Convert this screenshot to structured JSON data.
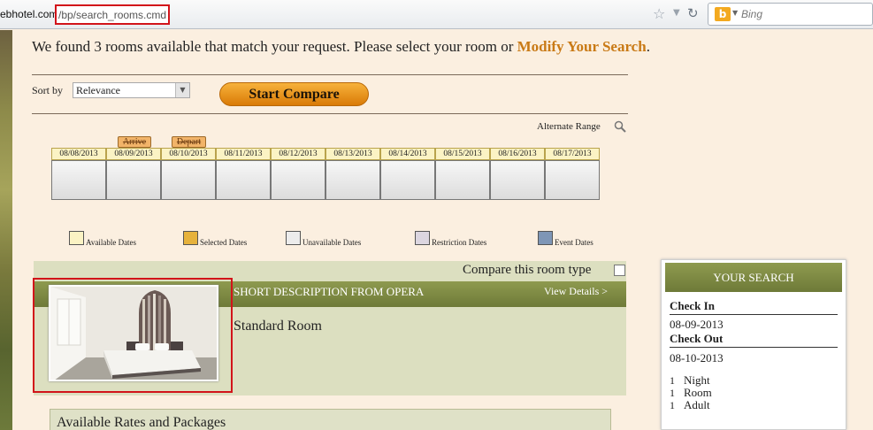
{
  "browser": {
    "url_host": "ebhotel.com",
    "url_path": "/bp/search_rooms.cmd",
    "search_engine": "Bing"
  },
  "header": {
    "found_text": "We found 3 rooms available that match your request. Please select your room or",
    "modify_link": "Modify Your Search",
    "period": "."
  },
  "sort": {
    "label": "Sort by",
    "selected": "Relevance"
  },
  "compare_button": "Start Compare",
  "alternate_range": "Alternate Range",
  "tags": {
    "arrive": "Arrive",
    "depart": "Depart"
  },
  "dates": [
    "08/08/2013",
    "08/09/2013",
    "08/10/2013",
    "08/11/2013",
    "08/12/2013",
    "08/13/2013",
    "08/14/2013",
    "08/15/2013",
    "08/16/2013",
    "08/17/2013"
  ],
  "legend": [
    {
      "label": "Available Dates",
      "color": "#fbf3c4"
    },
    {
      "label": "Selected Dates",
      "color": "#e6b23c"
    },
    {
      "label": "Unavailable Dates",
      "color": "#ececec"
    },
    {
      "label": "Restriction Dates",
      "color": "#dcd6e0"
    },
    {
      "label": "Event Dates",
      "color": "#7e96b6"
    }
  ],
  "room": {
    "compare_label": "Compare this room type",
    "short_description": "SHORT DESCRIPTION FROM OPERA",
    "view_details": "View Details >",
    "name": "Standard Room",
    "available_rates": "Available Rates and Packages"
  },
  "your_search": {
    "title": "YOUR SEARCH",
    "check_in_label": "Check In",
    "check_in": "08-09-2013",
    "check_out_label": "Check Out",
    "check_out": "08-10-2013",
    "nights_count": "1",
    "nights_label": "Night",
    "rooms_count": "1",
    "rooms_label": "Room",
    "adults_count": "1",
    "adults_label": "Adult"
  },
  "colors": {
    "accent": "#c97a16",
    "bar_green": "#7e8a43",
    "button_orange": "#e8960f"
  }
}
